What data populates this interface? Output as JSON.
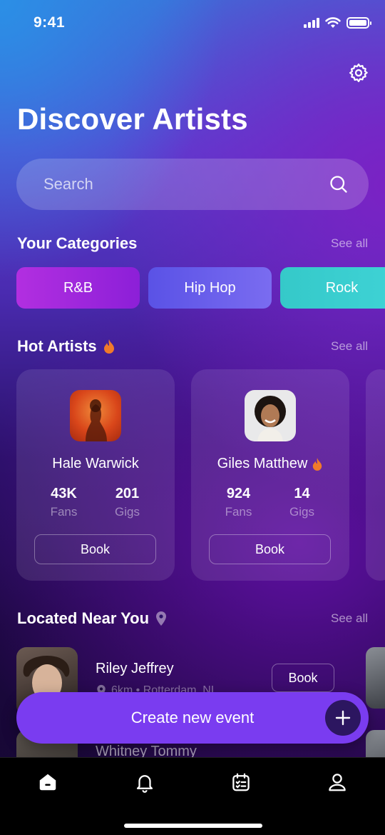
{
  "status_bar": {
    "time": "9:41"
  },
  "header": {
    "title": "Discover Artists"
  },
  "search": {
    "placeholder": "Search"
  },
  "categories": {
    "title": "Your Categories",
    "see_all": "See all",
    "items": [
      {
        "label": "R&B",
        "color": "#a62ade"
      },
      {
        "label": "Hip Hop",
        "color": "#6a60ec"
      },
      {
        "label": "Rock",
        "color": "#3acfd0"
      }
    ]
  },
  "hot_artists": {
    "title": "Hot Artists",
    "title_icon": "fire-icon",
    "see_all": "See all",
    "items": [
      {
        "name": "Hale Warwick",
        "fans": "43K",
        "gigs": "201",
        "fans_label": "Fans",
        "gigs_label": "Gigs",
        "book_label": "Book",
        "hot": false
      },
      {
        "name": "Giles Matthew",
        "fans": "924",
        "gigs": "14",
        "fans_label": "Fans",
        "gigs_label": "Gigs",
        "book_label": "Book",
        "hot": true
      }
    ]
  },
  "near_you": {
    "title": "Located Near You",
    "title_icon": "location-pin-icon",
    "see_all": "See all",
    "items": [
      {
        "name": "Riley Jeffrey",
        "location": "6km • Rotterdam, NL",
        "book_label": "Book"
      },
      {
        "name": "Whitney Tommy"
      }
    ]
  },
  "cta": {
    "label": "Create new event",
    "icon": "plus-icon"
  },
  "tab_bar": {
    "items": [
      {
        "icon": "home-icon",
        "active": true
      },
      {
        "icon": "bell-icon",
        "active": false
      },
      {
        "icon": "calendar-icon",
        "active": false
      },
      {
        "icon": "profile-icon",
        "active": false
      }
    ]
  },
  "colors": {
    "accent": "#7a3cf0",
    "fire": "#f07a2a"
  }
}
